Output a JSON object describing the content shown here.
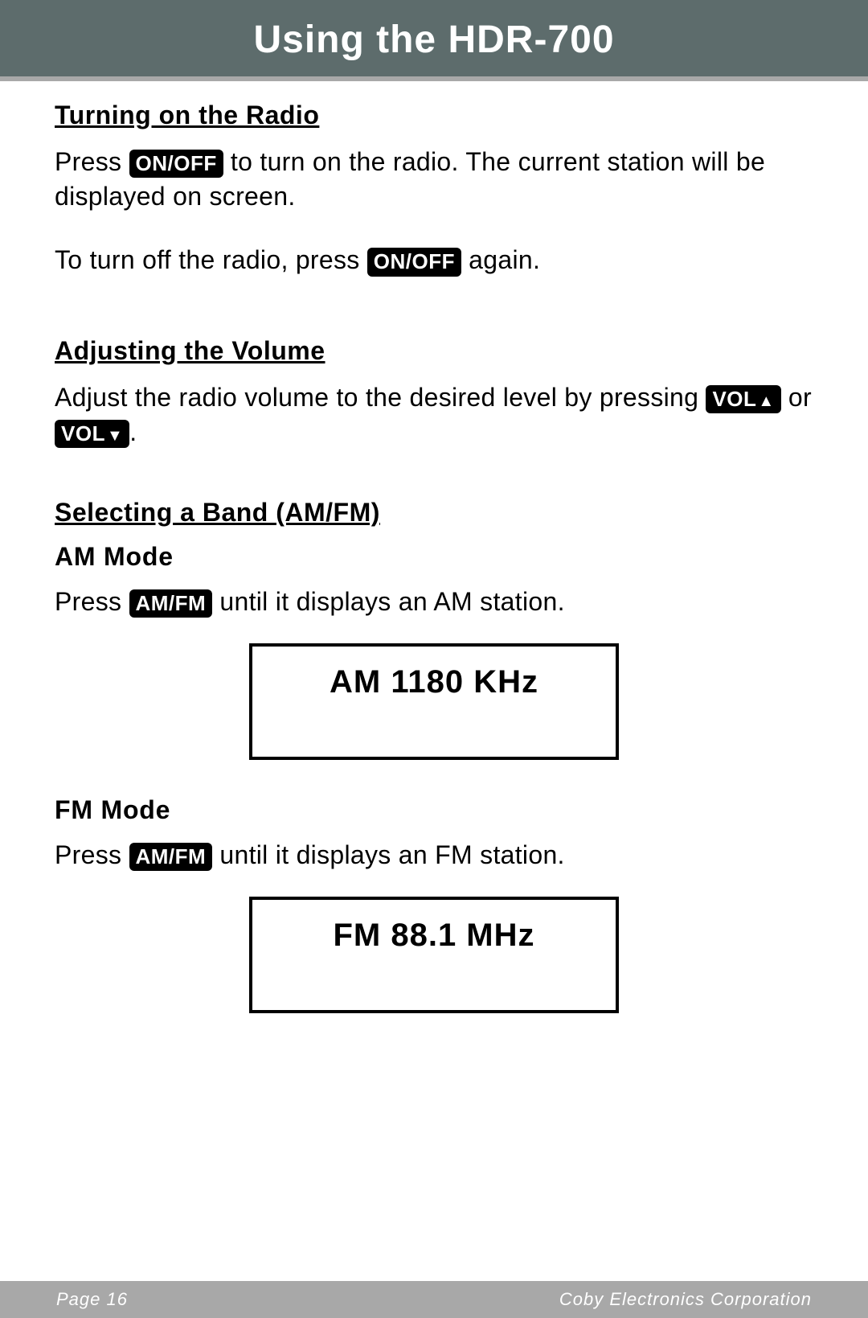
{
  "header": {
    "title": "Using the HDR-700"
  },
  "sections": {
    "turning_on": {
      "heading": "Turning on the Radio",
      "p1_a": "Press ",
      "p1_btn": "ON/OFF",
      "p1_b": " to turn on the radio. The current station will be displayed on screen.",
      "p2_a": "To turn off the radio, press ",
      "p2_btn": "ON/OFF",
      "p2_b": " again."
    },
    "volume": {
      "heading": "Adjusting the Volume",
      "p1_a": "Adjust the radio volume to the desired level by pressing ",
      "btn_up": "VOL",
      "mid": " or ",
      "btn_down": "VOL",
      "p1_b": "."
    },
    "band": {
      "heading": "Selecting a Band (AM/FM)",
      "am": {
        "subheading": "AM Mode",
        "p_a": "Press ",
        "btn": "AM/FM",
        "p_b": " until it displays an AM station.",
        "display": "AM  1180  KHz"
      },
      "fm": {
        "subheading": "FM Mode",
        "p_a": "Press ",
        "btn": "AM/FM",
        "p_b": " until it displays an FM station.",
        "display": "FM   88.1  MHz"
      }
    }
  },
  "footer": {
    "page": "Page 16",
    "company": "Coby Electronics Corporation"
  }
}
